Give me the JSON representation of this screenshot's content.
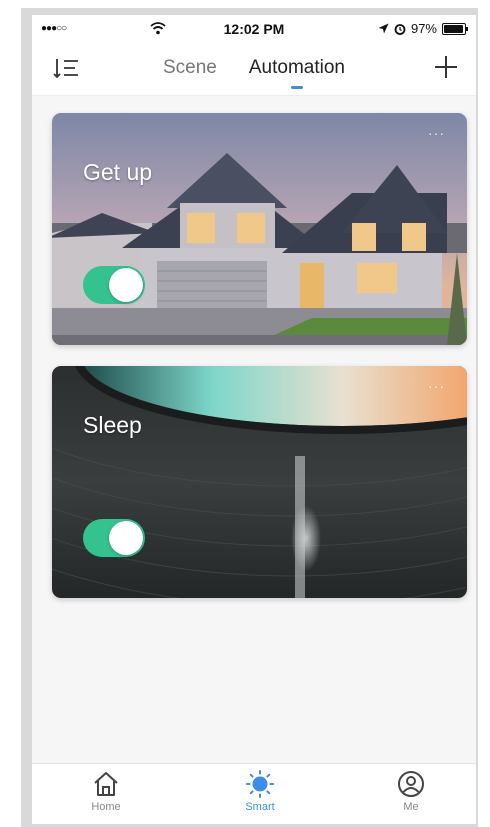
{
  "status_bar": {
    "signal": "●●●○○",
    "time": "12:02 PM",
    "battery_text": "97%",
    "battery_level": 0.97
  },
  "header": {
    "tabs": [
      {
        "label": "Scene",
        "active": false
      },
      {
        "label": "Automation",
        "active": true
      }
    ]
  },
  "cards": [
    {
      "title": "Get up",
      "more": "···",
      "enabled": true
    },
    {
      "title": "Sleep",
      "more": "···",
      "enabled": true
    }
  ],
  "bottom_nav": {
    "items": [
      {
        "label": "Home",
        "icon": "home-icon",
        "active": false
      },
      {
        "label": "Smart",
        "icon": "smart-sun-icon",
        "active": true
      },
      {
        "label": "Me",
        "icon": "user-icon",
        "active": false
      }
    ]
  },
  "colors": {
    "accent": "#3a8ee6",
    "toggle_on": "#34c38f"
  }
}
